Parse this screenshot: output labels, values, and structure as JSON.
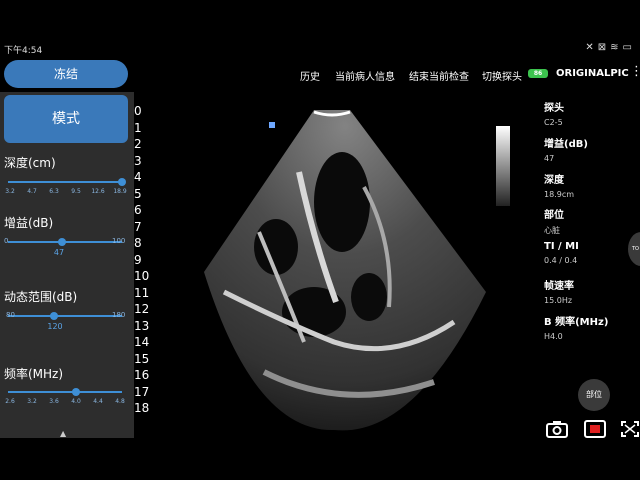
{
  "status": {
    "time": "下午4:54",
    "icons": [
      "mute-icon",
      "close-icon",
      "wifi-icon",
      "battery-icon"
    ]
  },
  "toolbar": {
    "freeze_label": "冻结",
    "history": "历史",
    "patient_info": "当前病人信息",
    "end_exam": "结束当前检查",
    "switch_probe": "切换探头",
    "battery": "86",
    "brand": "ORIGINALPIC"
  },
  "left": {
    "mode_label": "模式",
    "depth": {
      "title": "深度(cm)",
      "ticks": [
        "3.2",
        "4.7",
        "6.3",
        "9.5",
        "12.6",
        "18.9"
      ],
      "selected": "18.9"
    },
    "gain": {
      "title": "增益(dB)",
      "min": "0",
      "max": "100",
      "value": "47"
    },
    "dynamic_range": {
      "title": "动态范围(dB)",
      "min": "80",
      "max": "180",
      "value": "120"
    },
    "frequency": {
      "title": "频率(MHz)",
      "ticks": [
        "2.6",
        "3.2",
        "3.6",
        "4.0",
        "4.4",
        "4.8"
      ],
      "selected": "4.0"
    }
  },
  "depth_scale": [
    "0",
    "1",
    "2",
    "3",
    "4",
    "5",
    "6",
    "7",
    "8",
    "9",
    "10",
    "11",
    "12",
    "13",
    "14",
    "15",
    "16",
    "17",
    "18"
  ],
  "info": {
    "probe_label": "探头",
    "probe_value": "C2-5",
    "gain_label": "增益(dB)",
    "gain_value": "47",
    "depth_label": "深度",
    "depth_value": "18.9cm",
    "position_label": "部位",
    "position_value": "心脏",
    "ti_label": "TI / MI",
    "ti_value": "0.4 / 0.4",
    "frame_label": "帧速率",
    "frame_value": "15.0Hz",
    "bfreq_label": "B 频率(MHz)",
    "bfreq_value": "H4.0"
  },
  "position_button": "部位",
  "side_tab": "TO",
  "colors": {
    "accent": "#3a79ba",
    "slider": "#3e8fd6",
    "panel": "#2d2d2d",
    "battery": "#3cc34e",
    "record": "#e02020"
  }
}
